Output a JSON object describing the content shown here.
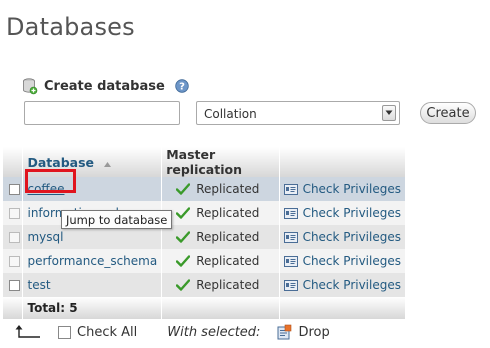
{
  "page": {
    "title": "Databases"
  },
  "create_database": {
    "heading": "Create database",
    "name_value": "",
    "collation_selected": "Collation",
    "create_label": "Create"
  },
  "table": {
    "headers": {
      "database": "Database",
      "replication": "Master replication"
    },
    "rows": [
      {
        "name": "coffee",
        "replication": "Replicated",
        "privileges": "Check Privileges"
      },
      {
        "name": "information_schema",
        "replication": "Replicated",
        "privileges": "Check Privileges"
      },
      {
        "name": "mysql",
        "replication": "Replicated",
        "privileges": "Check Privileges"
      },
      {
        "name": "performance_schema",
        "replication": "Replicated",
        "privileges": "Check Privileges"
      },
      {
        "name": "test",
        "replication": "Replicated",
        "privileges": "Check Privileges"
      }
    ],
    "total": "Total: 5"
  },
  "tooltip": {
    "text": "Jump to database"
  },
  "footer": {
    "check_all": "Check All",
    "with_selected": "With selected:",
    "drop": "Drop"
  },
  "colors": {
    "link": "#235a81",
    "highlight": "#e0141e",
    "check": "#3a9a2a"
  }
}
